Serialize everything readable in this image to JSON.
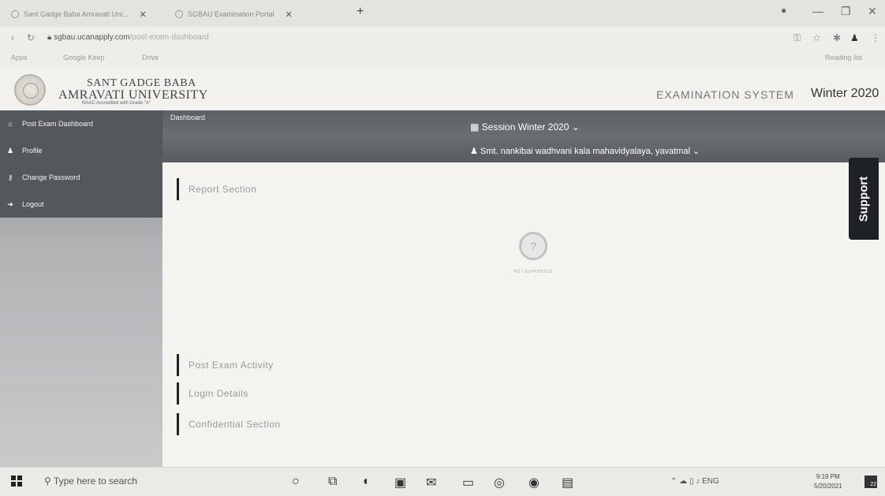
{
  "browser": {
    "tabs": [
      {
        "label": "Sant Gadge Baba Amravati Uni..."
      },
      {
        "label": "SGBAU Examination Portal"
      }
    ],
    "new_tab": "+",
    "window_controls": [
      "—",
      "❐",
      "✕"
    ],
    "url": "sgbau.ucanapply.com",
    "url_rest": "/post-exam-dashboard",
    "bookmarks": [
      "Apps",
      "Google Keep",
      "Drive"
    ],
    "reading_list": "Reading list"
  },
  "header": {
    "university_line1": "SANT GADGE BABA",
    "university_line2": "AMRAVATI UNIVERSITY",
    "university_line3": "NAAC Accredited with Grade \"A\"",
    "exam_system": "EXAMINATION SYSTEM",
    "term": "Winter 2020"
  },
  "sidebar": {
    "items": [
      {
        "label": "Post Exam Dashboard",
        "icon": "home-icon"
      },
      {
        "label": "Profile",
        "icon": "user-icon"
      },
      {
        "label": "Change Password",
        "icon": "key-icon"
      },
      {
        "label": "Logout",
        "icon": "logout-icon"
      }
    ]
  },
  "topbar": {
    "breadcrumb": "Dashboard",
    "session": "Session  Winter 2020",
    "college": "Smt. nankibai wadhvani kala mahavidyalaya, yavatmal"
  },
  "content": {
    "report_section": "Report Section",
    "no_support": "NOT SUPPORTED",
    "post_exam_activity": "Post Exam Activity",
    "login_details": "Login Details",
    "confidential_section": "Confidential Section"
  },
  "support_tab": "Support",
  "taskbar": {
    "search_placeholder": "Type here to search",
    "tray_lang": "ENG",
    "time": "9:19 PM",
    "date": "5/20/2021",
    "notifications": "22"
  }
}
